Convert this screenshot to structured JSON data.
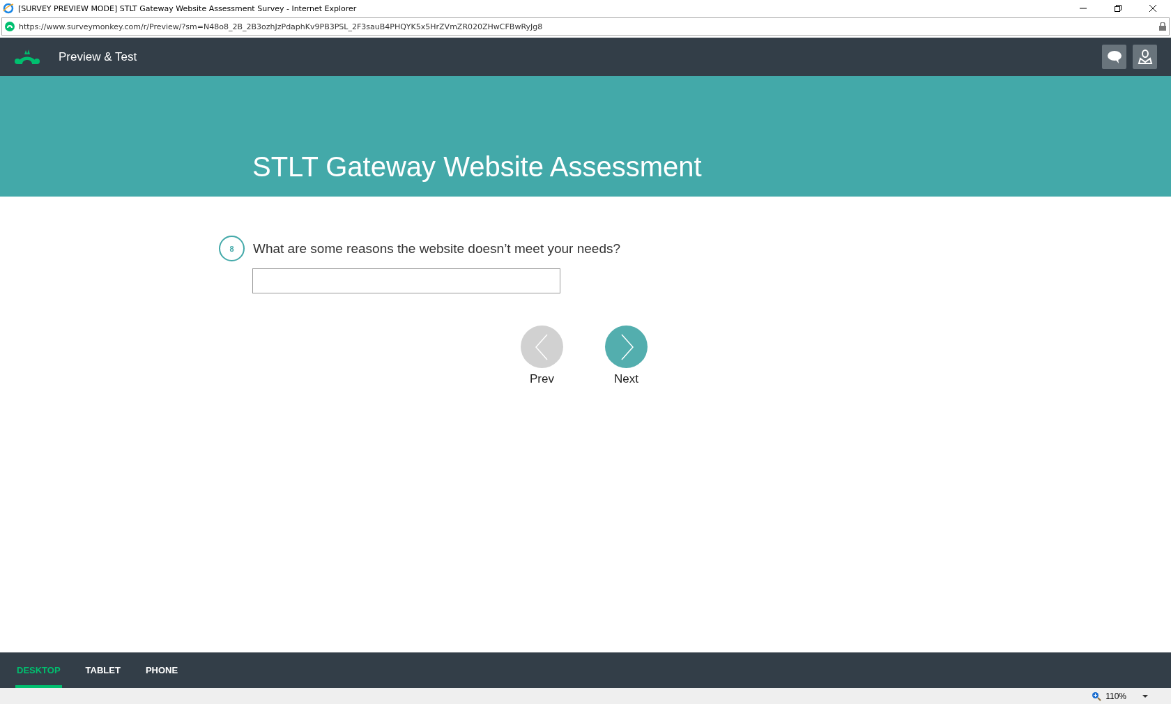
{
  "window": {
    "title": "[SURVEY PREVIEW MODE] STLT Gateway Website Assessment Survey - Internet Explorer"
  },
  "address_bar": {
    "url": "https://www.surveymonkey.com/r/Preview/?sm=N48o8_2B_2B3ozhJzPdaphKv9PB3PSL_2F3sauB4PHQYK5x5HrZVmZR020ZHwCFBwRyJg8"
  },
  "top_bar": {
    "title": "Preview & Test"
  },
  "banner": {
    "title": "STLT Gateway Website Assessment"
  },
  "question": {
    "number": "8",
    "text": "What are some reasons the website doesn’t meet your needs?"
  },
  "nav_buttons": [
    {
      "label": "Prev",
      "disabled": true
    },
    {
      "label": "Next",
      "disabled": false
    }
  ],
  "device_tabs": [
    {
      "label": "DESKTOP",
      "selected": true
    },
    {
      "label": "TABLET",
      "selected": false
    },
    {
      "label": "PHONE",
      "selected": false
    }
  ],
  "status_bar": {
    "zoom": "110%"
  }
}
